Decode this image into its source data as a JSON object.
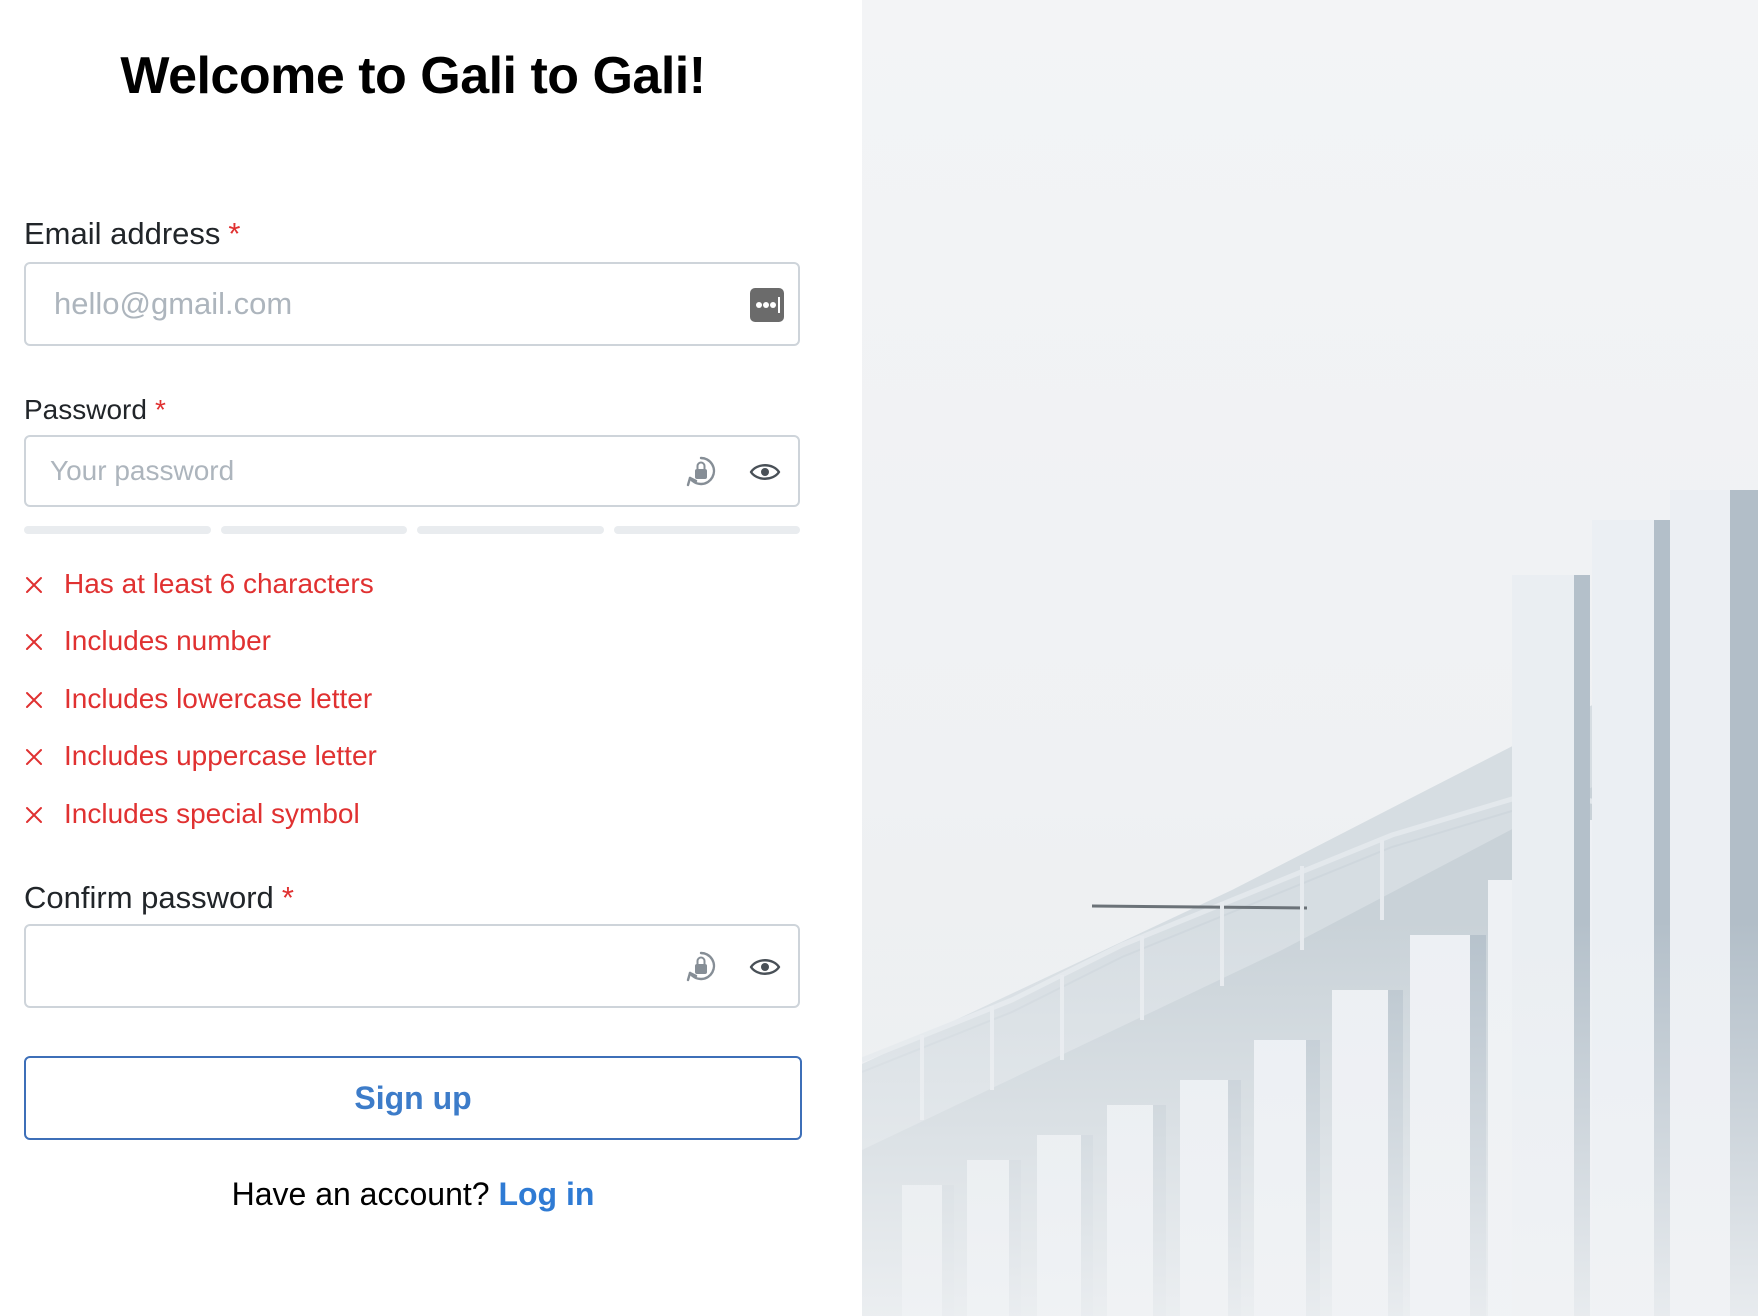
{
  "page": {
    "title": "Welcome to Gali to Gali!"
  },
  "form": {
    "email": {
      "label": "Email address",
      "required_mark": "*",
      "placeholder": "hello@gmail.com",
      "value": ""
    },
    "password": {
      "label": "Password",
      "required_mark": "*",
      "placeholder": "Your password",
      "value": "",
      "strength_segments_filled": 0,
      "strength_segments_total": 4
    },
    "requirements": [
      {
        "label": "Has at least 6 characters",
        "met": false
      },
      {
        "label": "Includes number",
        "met": false
      },
      {
        "label": "Includes lowercase letter",
        "met": false
      },
      {
        "label": "Includes uppercase letter",
        "met": false
      },
      {
        "label": "Includes special symbol",
        "met": false
      }
    ],
    "confirm_password": {
      "label": "Confirm password",
      "required_mark": "*",
      "placeholder": "",
      "value": ""
    },
    "submit_label": "Sign up"
  },
  "footer": {
    "prompt": "Have an account?",
    "link_label": "Log in"
  },
  "colors": {
    "error": "#e03131",
    "accent": "#3d7cc9",
    "border": "#ced4da"
  },
  "icons": {
    "email_autofill": "password-autofill-icon",
    "password_manager": "key-lock-icon",
    "reveal": "eye-icon",
    "requirement_status": "x-icon"
  }
}
